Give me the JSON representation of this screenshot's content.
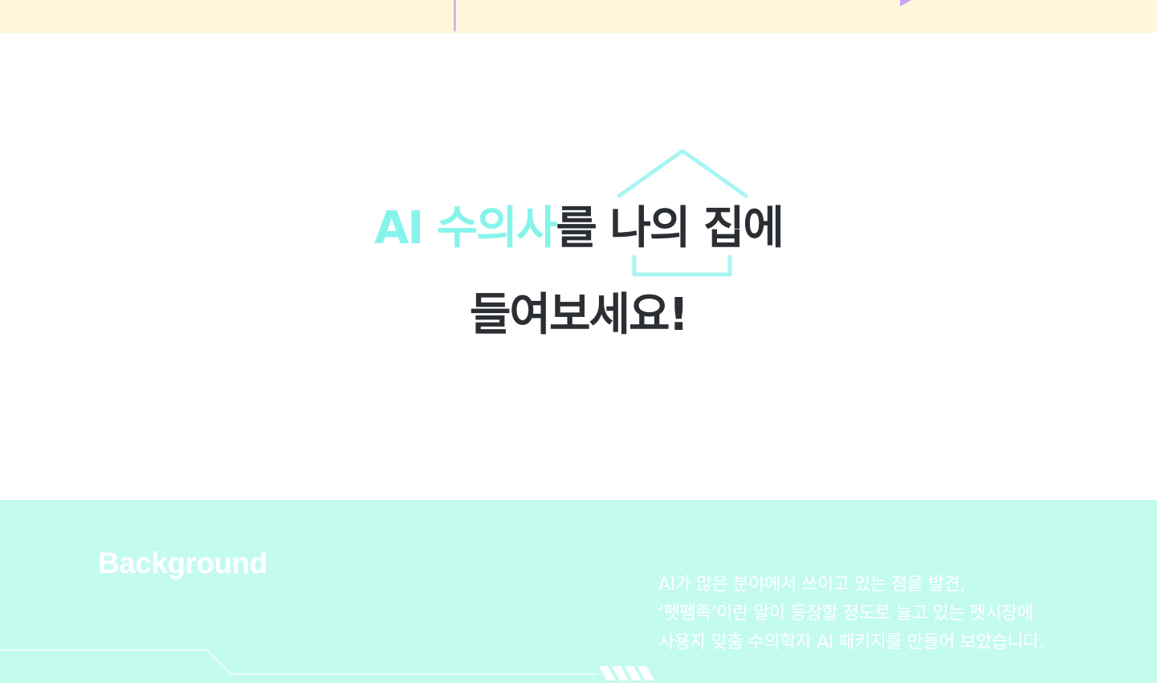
{
  "headline": {
    "line1_accent": "AI 수의사",
    "line1_rest": "를 나의 집에",
    "line2": "들여보세요!"
  },
  "background_section": {
    "title": "Background",
    "paragraph_lines": [
      "AI가 많은 분야에서 쓰이고 있는 점을 발견,",
      "‘펫펨족’이란 말이 등장할 정도로 늘고 있는 펫시장에",
      "사용자 맞춤 수의학자 AI 패키지를 만들어 보았습니다."
    ]
  },
  "colors": {
    "top_band": "#fff6dc",
    "accent_mint": "#86f4ea",
    "house_outline": "#a8f6f3",
    "section_mint": "#c4fbef",
    "headline_dark": "#2b2f33",
    "lavender": "#d4b4f0"
  }
}
